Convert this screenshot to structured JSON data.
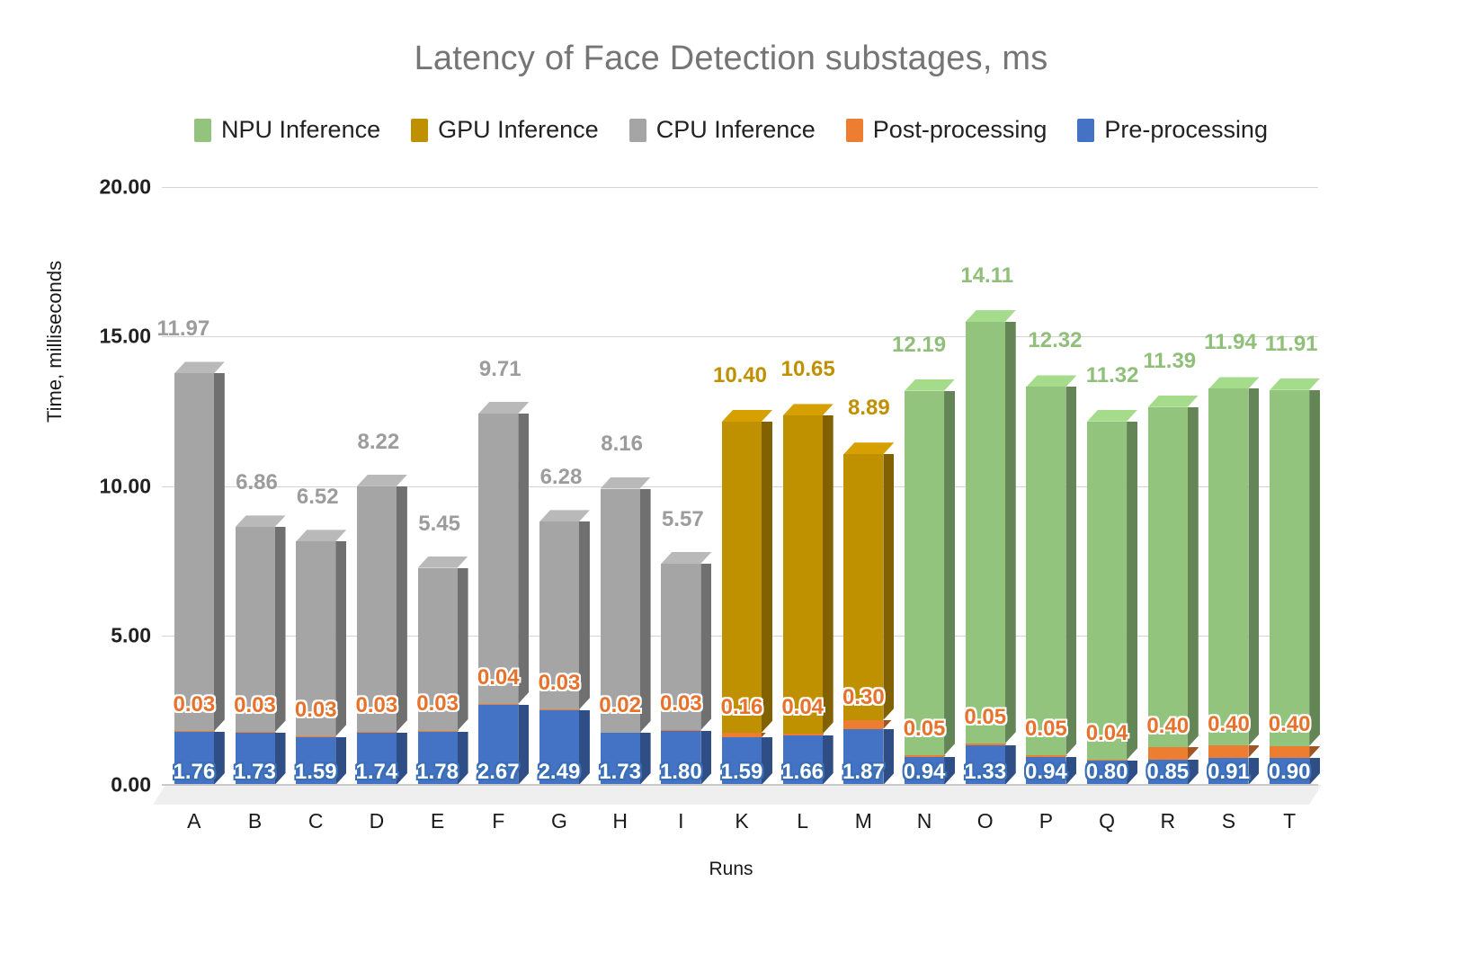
{
  "chart_data": {
    "type": "bar",
    "stacked": true,
    "title": "Latency of Face Detection substages, ms",
    "xlabel": "Runs",
    "ylabel": "Time, milliseconds",
    "ylim": [
      0,
      20
    ],
    "ytick_labels": [
      "0.00",
      "5.00",
      "10.00",
      "15.00",
      "20.00"
    ],
    "ytick_values": [
      0,
      5,
      10,
      15,
      20
    ],
    "grid": true,
    "legend_position": "top",
    "categories": [
      "A",
      "B",
      "C",
      "D",
      "E",
      "F",
      "G",
      "H",
      "I",
      "K",
      "L",
      "M",
      "N",
      "O",
      "P",
      "Q",
      "R",
      "S",
      "T"
    ],
    "series": [
      {
        "name": "NPU Inference",
        "color": "#93C47D",
        "values": [
          null,
          null,
          null,
          null,
          null,
          null,
          null,
          null,
          null,
          null,
          null,
          null,
          12.19,
          14.11,
          12.32,
          11.32,
          11.39,
          11.94,
          11.91
        ]
      },
      {
        "name": "GPU Inference",
        "color": "#BF9000",
        "values": [
          null,
          null,
          null,
          null,
          null,
          null,
          null,
          null,
          null,
          10.4,
          10.65,
          8.89,
          null,
          null,
          null,
          null,
          null,
          null,
          null
        ]
      },
      {
        "name": "CPU Inference",
        "color": "#A5A5A5",
        "values": [
          11.97,
          6.86,
          6.52,
          8.22,
          5.45,
          9.71,
          6.28,
          8.16,
          5.57,
          null,
          null,
          null,
          null,
          null,
          null,
          null,
          null,
          null,
          null
        ]
      },
      {
        "name": "Post-processing",
        "color": "#ED7D31",
        "values": [
          0.03,
          0.03,
          0.03,
          0.03,
          0.03,
          0.04,
          0.03,
          0.02,
          0.03,
          0.16,
          0.04,
          0.3,
          0.05,
          0.05,
          0.05,
          0.04,
          0.4,
          0.4,
          0.4
        ]
      },
      {
        "name": "Pre-processing",
        "color": "#4472C4",
        "values": [
          1.76,
          1.73,
          1.59,
          1.74,
          1.78,
          2.67,
          2.49,
          1.73,
          1.8,
          1.59,
          1.66,
          1.87,
          0.94,
          1.33,
          0.94,
          0.8,
          0.85,
          0.91,
          0.9
        ]
      }
    ]
  },
  "legend": {
    "items": [
      {
        "label": "NPU Inference",
        "color": "#93C47D"
      },
      {
        "label": "GPU Inference",
        "color": "#BF9000"
      },
      {
        "label": "CPU Inference",
        "color": "#A5A5A5"
      },
      {
        "label": "Post-processing",
        "color": "#ED7D31"
      },
      {
        "label": "Pre-processing",
        "color": "#4472C4"
      }
    ]
  }
}
